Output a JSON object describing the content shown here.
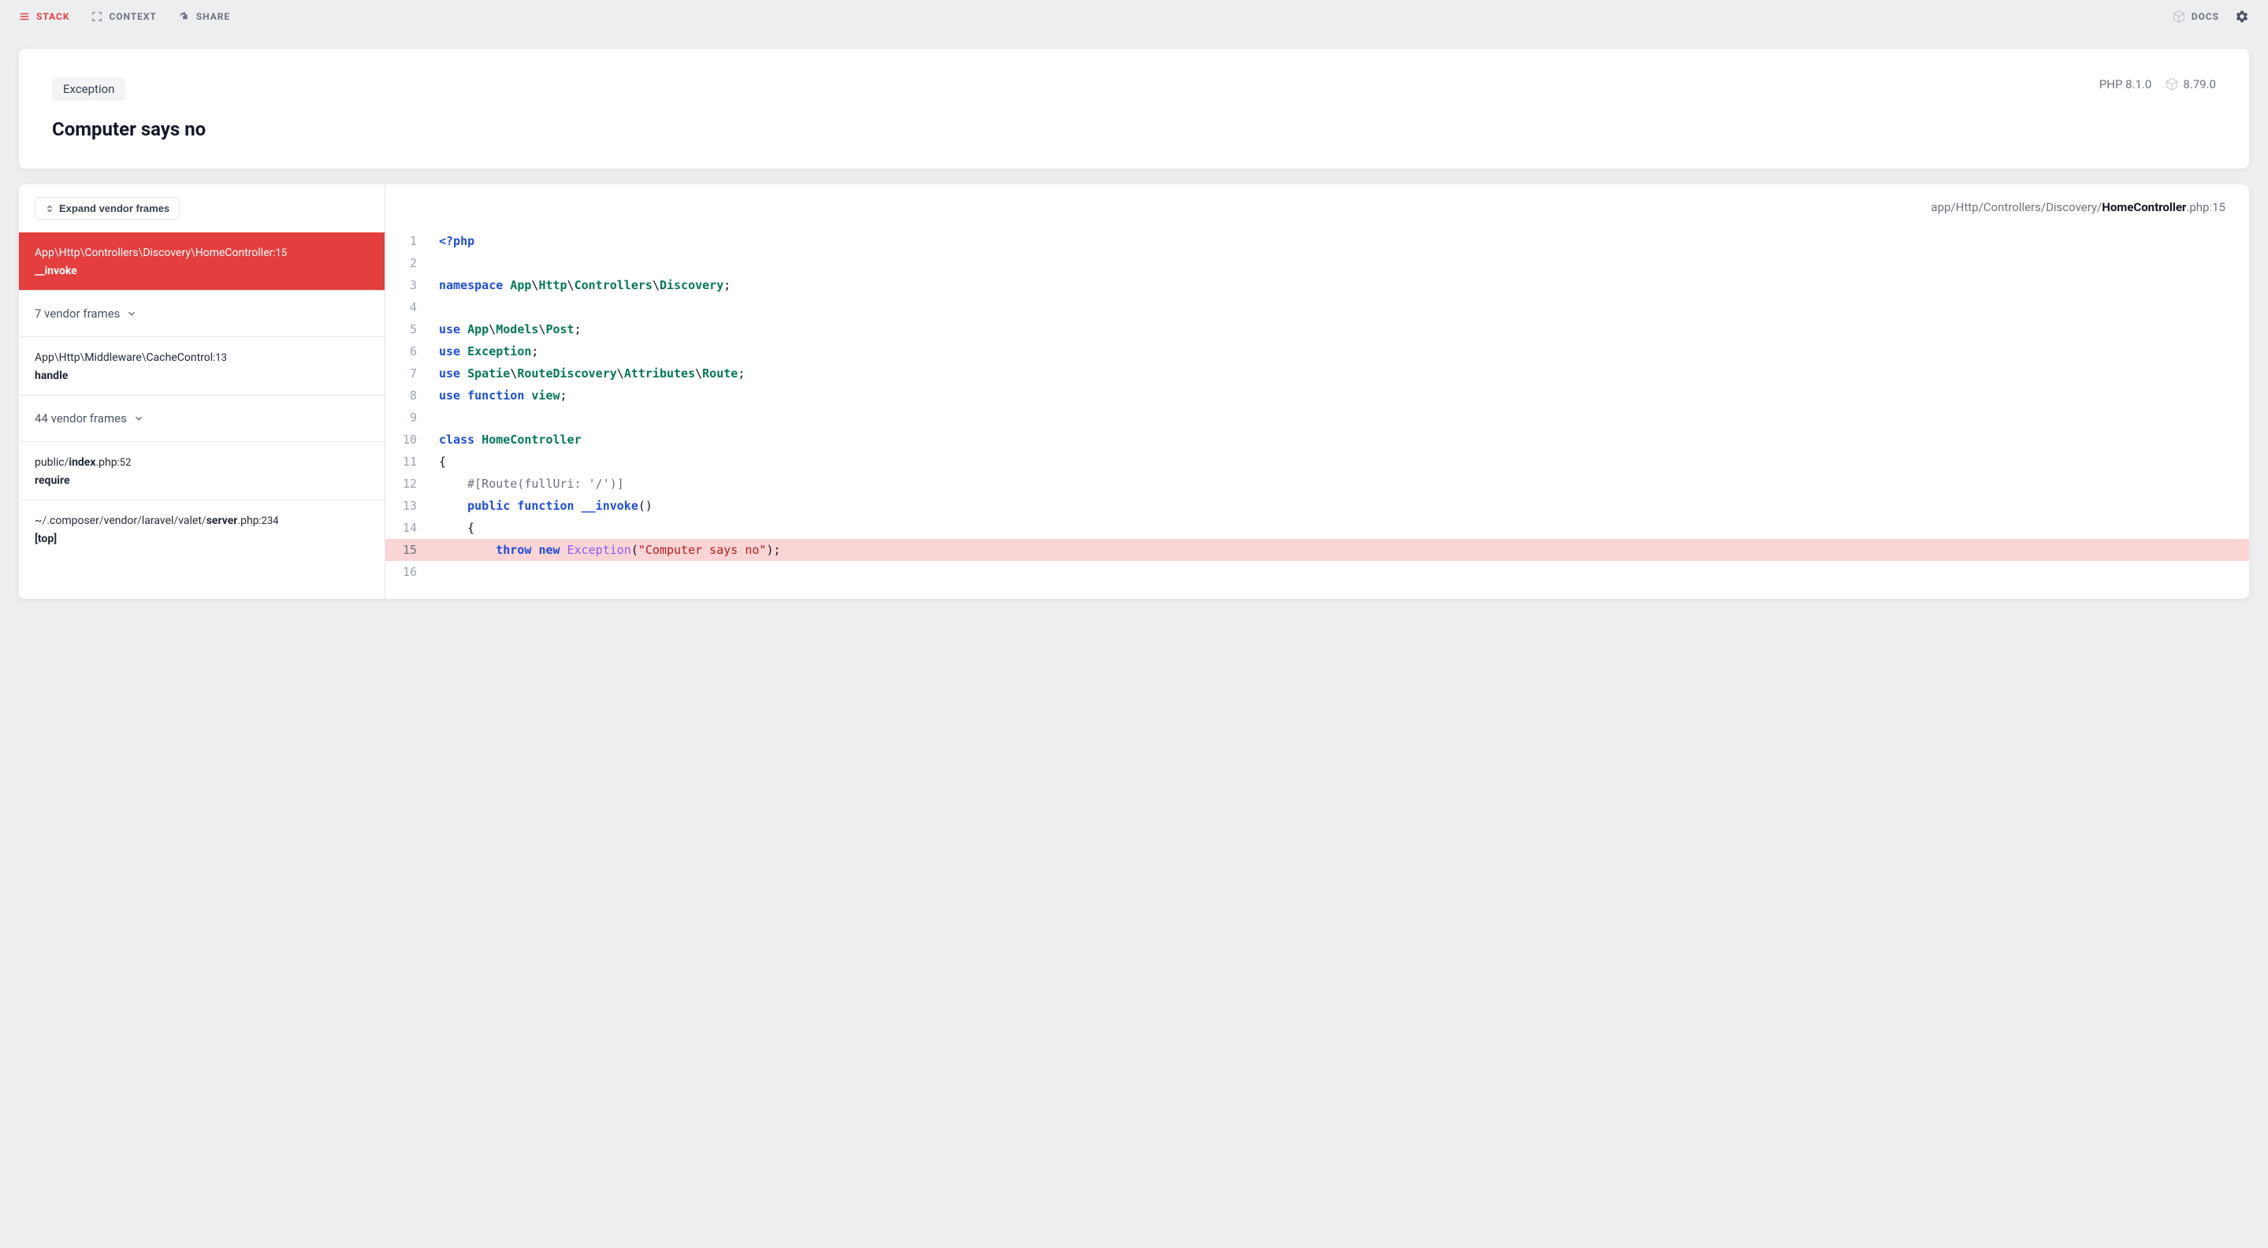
{
  "topbar": {
    "stack": "STACK",
    "context": "CONTEXT",
    "share": "SHARE",
    "docs": "DOCS"
  },
  "exception": {
    "pill": "Exception",
    "title": "Computer says no",
    "php_label": "PHP 8.1.0",
    "laravel_version": "8.79.0"
  },
  "frames": {
    "expand_label": "Expand vendor frames",
    "list": [
      {
        "type": "frame",
        "active": true,
        "segments": [
          {
            "t": "App",
            "d": false
          },
          {
            "t": "\\",
            "d": true
          },
          {
            "t": "Http",
            "d": false
          },
          {
            "t": "\\",
            "d": true
          },
          {
            "t": "Controllers",
            "d": false
          },
          {
            "t": "\\",
            "d": true
          },
          {
            "t": "Discovery",
            "d": false
          },
          {
            "t": "\\",
            "d": true
          },
          {
            "t": "HomeController",
            "d": false
          }
        ],
        "line": "15",
        "method": "__invoke"
      },
      {
        "type": "vendor",
        "label": "7 vendor frames"
      },
      {
        "type": "frame",
        "active": false,
        "segments": [
          {
            "t": "App",
            "d": false
          },
          {
            "t": "\\",
            "d": true
          },
          {
            "t": "Http",
            "d": false
          },
          {
            "t": "\\",
            "d": true
          },
          {
            "t": "Middleware",
            "d": false
          },
          {
            "t": "\\",
            "d": true
          },
          {
            "t": "CacheControl",
            "d": false
          }
        ],
        "line": "13",
        "method": "handle"
      },
      {
        "type": "vendor",
        "label": "44 vendor frames"
      },
      {
        "type": "frame",
        "active": false,
        "segments": [
          {
            "t": "public",
            "d": false
          },
          {
            "t": "/",
            "d": true
          },
          {
            "t": "index",
            "d": false,
            "strong": true
          },
          {
            "t": ".php",
            "d": false
          }
        ],
        "line": "52",
        "method": "require"
      },
      {
        "type": "frame",
        "active": false,
        "segments": [
          {
            "t": "~",
            "d": false
          },
          {
            "t": "/",
            "d": true
          },
          {
            "t": ".composer",
            "d": false
          },
          {
            "t": "/",
            "d": true
          },
          {
            "t": "vendor",
            "d": false
          },
          {
            "t": "/",
            "d": true
          },
          {
            "t": "laravel",
            "d": false
          },
          {
            "t": "/",
            "d": true
          },
          {
            "t": "valet",
            "d": false
          },
          {
            "t": "/",
            "d": true
          },
          {
            "t": "server",
            "d": false,
            "strong": true
          },
          {
            "t": ".php",
            "d": false
          }
        ],
        "line": "234",
        "method": "[top]"
      }
    ]
  },
  "crumb": {
    "parts": [
      {
        "t": "app",
        "b": false
      },
      {
        "t": "/",
        "b": false
      },
      {
        "t": "Http",
        "b": false
      },
      {
        "t": "/",
        "b": false
      },
      {
        "t": "Controllers",
        "b": false
      },
      {
        "t": "/",
        "b": false
      },
      {
        "t": "Discovery",
        "b": false
      },
      {
        "t": "/",
        "b": false
      },
      {
        "t": "HomeController",
        "b": true
      },
      {
        "t": ".php",
        "b": false
      }
    ],
    "line": "15"
  },
  "code": [
    {
      "n": 1,
      "hl": false,
      "tokens": [
        {
          "c": "tk-kw",
          "t": "<?php"
        }
      ]
    },
    {
      "n": 2,
      "hl": false,
      "tokens": []
    },
    {
      "n": 3,
      "hl": false,
      "tokens": [
        {
          "c": "tk-kw",
          "t": "namespace"
        },
        {
          "c": "tk-plain",
          "t": " "
        },
        {
          "c": "tk-ns",
          "t": "App"
        },
        {
          "c": "tk-pn",
          "t": "\\"
        },
        {
          "c": "tk-ns",
          "t": "Http"
        },
        {
          "c": "tk-pn",
          "t": "\\"
        },
        {
          "c": "tk-ns",
          "t": "Controllers"
        },
        {
          "c": "tk-pn",
          "t": "\\"
        },
        {
          "c": "tk-ns",
          "t": "Discovery"
        },
        {
          "c": "tk-pn",
          "t": ";"
        }
      ]
    },
    {
      "n": 4,
      "hl": false,
      "tokens": []
    },
    {
      "n": 5,
      "hl": false,
      "tokens": [
        {
          "c": "tk-kw",
          "t": "use"
        },
        {
          "c": "tk-plain",
          "t": " "
        },
        {
          "c": "tk-ns",
          "t": "App"
        },
        {
          "c": "tk-pn",
          "t": "\\"
        },
        {
          "c": "tk-ns",
          "t": "Models"
        },
        {
          "c": "tk-pn",
          "t": "\\"
        },
        {
          "c": "tk-ns",
          "t": "Post"
        },
        {
          "c": "tk-pn",
          "t": ";"
        }
      ]
    },
    {
      "n": 6,
      "hl": false,
      "tokens": [
        {
          "c": "tk-kw",
          "t": "use"
        },
        {
          "c": "tk-plain",
          "t": " "
        },
        {
          "c": "tk-ns",
          "t": "Exception"
        },
        {
          "c": "tk-pn",
          "t": ";"
        }
      ]
    },
    {
      "n": 7,
      "hl": false,
      "tokens": [
        {
          "c": "tk-kw",
          "t": "use"
        },
        {
          "c": "tk-plain",
          "t": " "
        },
        {
          "c": "tk-ns",
          "t": "Spatie"
        },
        {
          "c": "tk-pn",
          "t": "\\"
        },
        {
          "c": "tk-ns",
          "t": "RouteDiscovery"
        },
        {
          "c": "tk-pn",
          "t": "\\"
        },
        {
          "c": "tk-ns",
          "t": "Attributes"
        },
        {
          "c": "tk-pn",
          "t": "\\"
        },
        {
          "c": "tk-ns",
          "t": "Route"
        },
        {
          "c": "tk-pn",
          "t": ";"
        }
      ]
    },
    {
      "n": 8,
      "hl": false,
      "tokens": [
        {
          "c": "tk-kw",
          "t": "use"
        },
        {
          "c": "tk-plain",
          "t": " "
        },
        {
          "c": "tk-kw",
          "t": "function"
        },
        {
          "c": "tk-plain",
          "t": " "
        },
        {
          "c": "tk-ns",
          "t": "view"
        },
        {
          "c": "tk-pn",
          "t": ";"
        }
      ]
    },
    {
      "n": 9,
      "hl": false,
      "tokens": []
    },
    {
      "n": 10,
      "hl": false,
      "tokens": [
        {
          "c": "tk-kw",
          "t": "class"
        },
        {
          "c": "tk-plain",
          "t": " "
        },
        {
          "c": "tk-ns",
          "t": "HomeController"
        }
      ]
    },
    {
      "n": 11,
      "hl": false,
      "tokens": [
        {
          "c": "tk-pn",
          "t": "{"
        }
      ]
    },
    {
      "n": 12,
      "hl": false,
      "tokens": [
        {
          "c": "tk-plain",
          "t": "    "
        },
        {
          "c": "tk-cmt",
          "t": "#[Route(fullUri: '/')]"
        }
      ]
    },
    {
      "n": 13,
      "hl": false,
      "tokens": [
        {
          "c": "tk-plain",
          "t": "    "
        },
        {
          "c": "tk-kw",
          "t": "public"
        },
        {
          "c": "tk-plain",
          "t": " "
        },
        {
          "c": "tk-kw",
          "t": "function"
        },
        {
          "c": "tk-plain",
          "t": " "
        },
        {
          "c": "tk-fn",
          "t": "__invoke"
        },
        {
          "c": "tk-pn",
          "t": "()"
        }
      ]
    },
    {
      "n": 14,
      "hl": false,
      "tokens": [
        {
          "c": "tk-plain",
          "t": "    "
        },
        {
          "c": "tk-pn",
          "t": "{"
        }
      ]
    },
    {
      "n": 15,
      "hl": true,
      "tokens": [
        {
          "c": "tk-plain",
          "t": "        "
        },
        {
          "c": "tk-kw",
          "t": "throw"
        },
        {
          "c": "tk-plain",
          "t": " "
        },
        {
          "c": "tk-kw",
          "t": "new"
        },
        {
          "c": "tk-plain",
          "t": " "
        },
        {
          "c": "tk-cls",
          "t": "Exception"
        },
        {
          "c": "tk-pn",
          "t": "("
        },
        {
          "c": "tk-str",
          "t": "\"Computer says no\""
        },
        {
          "c": "tk-pn",
          "t": ");"
        }
      ]
    },
    {
      "n": 16,
      "hl": false,
      "tokens": []
    }
  ]
}
